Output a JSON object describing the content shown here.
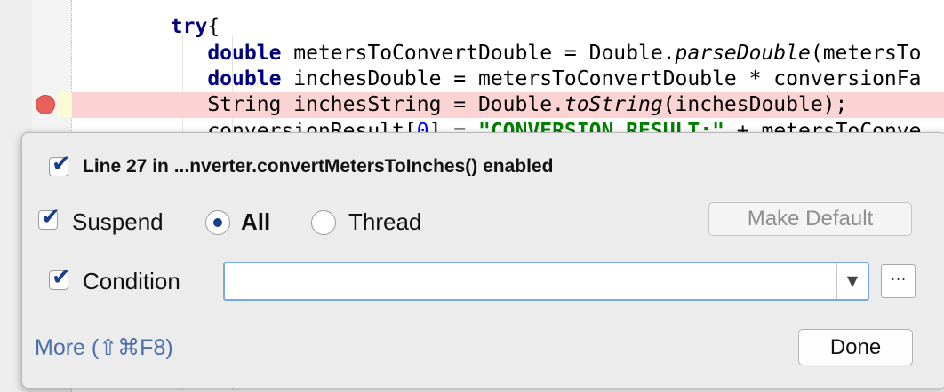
{
  "editor": {
    "lines": [
      {
        "seg": [
          {
            "t": "        ",
            "c": ""
          },
          {
            "t": "try",
            "c": "kw"
          },
          {
            "t": "{",
            "c": ""
          }
        ]
      },
      {
        "seg": [
          {
            "t": "           ",
            "c": ""
          },
          {
            "t": "double",
            "c": "kw"
          },
          {
            "t": " metersToConvertDouble = Double.",
            "c": ""
          },
          {
            "t": "parseDouble",
            "c": "it"
          },
          {
            "t": "(metersTo",
            "c": ""
          }
        ]
      },
      {
        "seg": [
          {
            "t": "           ",
            "c": ""
          },
          {
            "t": "double",
            "c": "kw"
          },
          {
            "t": " inchesDouble = metersToConvertDouble * conversionFa",
            "c": ""
          }
        ]
      },
      {
        "seg": [
          {
            "t": "           String inchesString = Double.",
            "c": ""
          },
          {
            "t": "toString",
            "c": "it"
          },
          {
            "t": "(inchesDouble);",
            "c": ""
          }
        ]
      },
      {
        "seg": [
          {
            "t": "           conversionResult[",
            "c": ""
          },
          {
            "t": "0",
            "c": "num"
          },
          {
            "t": "] = ",
            "c": ""
          },
          {
            "t": "\"CONVERSION RESULT:\"",
            "c": "str"
          },
          {
            "t": " + metersToConve",
            "c": ""
          }
        ]
      }
    ],
    "breakpoint_color": "#e8605a",
    "breakpoint_line_color": "#fbd3d3"
  },
  "popup": {
    "title": "Line 27 in ...nverter.convertMetersToInches() enabled",
    "title_checked": true,
    "suspend_label": "Suspend",
    "suspend_checked": true,
    "radio_all_label": "All",
    "radio_thread_label": "Thread",
    "selected_radio": "All",
    "make_default_label": "Make Default",
    "condition_label": "Condition",
    "condition_checked": true,
    "condition_value": "",
    "ellipsis_label": "···",
    "more_label": "More (⇧⌘F8)",
    "done_label": "Done",
    "accent_color": "#1a3e8a",
    "link_color": "#4a6ea9"
  },
  "icons": {
    "checkbox_check": "✔",
    "dropdown_arrow": "▼",
    "breakpoint": "breakpoint-icon"
  }
}
